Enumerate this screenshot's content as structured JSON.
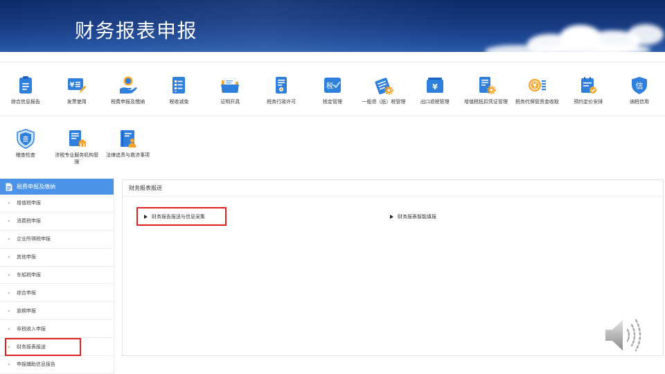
{
  "header": {
    "title": "财务报表申报"
  },
  "services": {
    "row1": [
      {
        "label": "综合信息报告",
        "icon": "clipboard-icon"
      },
      {
        "label": "发票使用",
        "icon": "invoice-pen-icon",
        "glyph": "¥"
      },
      {
        "label": "税费申报及缴纳",
        "icon": "hand-coin-icon"
      },
      {
        "label": "税收减免",
        "icon": "list-document-icon"
      },
      {
        "label": "证明开具",
        "icon": "folder-icon"
      },
      {
        "label": "税务行政许可",
        "icon": "certificate-document-icon"
      },
      {
        "label": "核定管理",
        "icon": "tax-check-icon",
        "glyph": "税"
      },
      {
        "label": "一般退（抵）税管理",
        "icon": "card-gear-icon"
      },
      {
        "label": "出口退税管理",
        "icon": "yuan-card-icon",
        "glyph": "¥"
      },
      {
        "label": "增值税抵扣凭证管理",
        "icon": "document-gear-icon"
      },
      {
        "label": "税务代保管资金收取",
        "icon": "coin-list-icon"
      },
      {
        "label": "预约定价安排",
        "icon": "calendar-check-icon"
      },
      {
        "label": "纳税信用",
        "icon": "credit-shield-icon",
        "glyph": "信"
      }
    ],
    "row2": [
      {
        "label": "稽查检查",
        "icon": "inspection-shield-icon",
        "glyph": "查"
      },
      {
        "label": "涉税专业服务机构管理",
        "icon": "document-building-icon"
      },
      {
        "label": "法律追责与救济事项",
        "icon": "book-person-icon"
      }
    ]
  },
  "sidebar": {
    "title": "税费申报及缴纳",
    "icon": "document-icon",
    "items": [
      {
        "label": "增值税申报"
      },
      {
        "label": "消费税申报"
      },
      {
        "label": "企业所得税申报"
      },
      {
        "label": "其他申报"
      },
      {
        "label": "车船税申报"
      },
      {
        "label": "综合申报"
      },
      {
        "label": "逾期申报"
      },
      {
        "label": "非税收入申报"
      },
      {
        "label": "财务报表报送",
        "highlighted": true
      },
      {
        "label": "申报辅助信息报告"
      }
    ]
  },
  "main": {
    "title": "财务报表报送",
    "links": [
      {
        "label": "财务报告报送与信息采集",
        "highlighted": true
      },
      {
        "label": "财务报表智能填报"
      }
    ]
  },
  "audio": {
    "icon": "speaker-icon"
  },
  "colors": {
    "header_background": "#16397f",
    "sidebar_header": "#4a93e8",
    "icon_blue": "#2f80dd",
    "icon_orange": "#f5a52a",
    "highlight_red": "#e02020"
  }
}
